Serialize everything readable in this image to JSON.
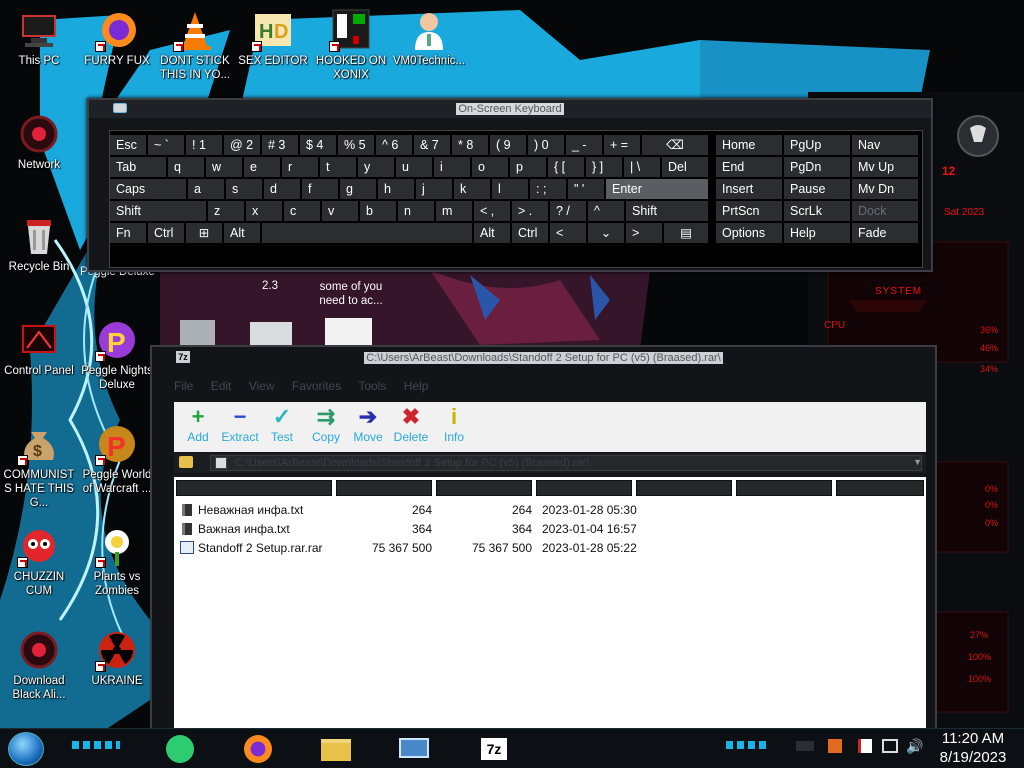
{
  "desktop": {
    "icons": [
      {
        "label": "This PC"
      },
      {
        "label": "FURRY FUX"
      },
      {
        "label": "DONT STICK THIS IN YO..."
      },
      {
        "label": "SEX EDITOR"
      },
      {
        "label": "HOOKED ON XONIX"
      },
      {
        "label": "VM0Technic..."
      },
      {
        "label": "Network"
      },
      {
        "label": "Recycle Bin"
      },
      {
        "label": "Control Panel"
      },
      {
        "label": "Peggle Nights Deluxe"
      },
      {
        "label": "COMMUNISTS HATE THIS G..."
      },
      {
        "label": "Peggle World of Warcraft ..."
      },
      {
        "label": "CHUZZIN CUM"
      },
      {
        "label": "Plants vs Zombies"
      },
      {
        "label": "Download Black Ali..."
      },
      {
        "label": "UKRAINE"
      }
    ],
    "hidden_labels": [
      "Peggle Deluxe",
      "2.3",
      "some of you need to ac..."
    ]
  },
  "osk": {
    "title": "On-Screen Keyboard",
    "row1": [
      "Esc",
      "~ `",
      "! 1",
      "@ 2",
      "# 3",
      "$ 4",
      "% 5",
      "^ 6",
      "& 7",
      "* 8",
      "( 9",
      ") 0",
      "_ -",
      "+ =",
      "⌫"
    ],
    "row2": [
      "Tab",
      "q",
      "w",
      "e",
      "r",
      "t",
      "y",
      "u",
      "i",
      "o",
      "p",
      "{ [",
      "} ]",
      "| \\",
      "Del"
    ],
    "row3": [
      "Caps",
      "a",
      "s",
      "d",
      "f",
      "g",
      "h",
      "j",
      "k",
      "l",
      ": ;",
      "\" '",
      "Enter"
    ],
    "row4": [
      "Shift",
      "z",
      "x",
      "c",
      "v",
      "b",
      "n",
      "m",
      "< ,",
      "> .",
      "? /",
      "^",
      "Shift"
    ],
    "row5": [
      "Fn",
      "Ctrl",
      "⊞",
      "Alt",
      "Alt",
      "Ctrl",
      "<",
      "⌄",
      ">",
      "▤"
    ],
    "nav": [
      [
        "Home",
        "PgUp",
        "Nav"
      ],
      [
        "End",
        "PgDn",
        "Mv Up"
      ],
      [
        "Insert",
        "Pause",
        "Mv Dn"
      ],
      [
        "PrtScn",
        "ScrLk",
        "Dock"
      ],
      [
        "Options",
        "Help",
        "Fade"
      ]
    ]
  },
  "zip": {
    "title": "C:\\Users\\ArBeast\\Downloads\\Standoff 2 Setup for PC (v5) (Braased).rar\\",
    "menu": [
      "File",
      "Edit",
      "View",
      "Favorites",
      "Tools",
      "Help"
    ],
    "toolbar": [
      {
        "label": "Add",
        "icon": "plus",
        "color": "#1fa33a"
      },
      {
        "label": "Extract",
        "icon": "minus",
        "color": "#2a4bd0"
      },
      {
        "label": "Test",
        "icon": "check",
        "color": "#2cb6c7"
      },
      {
        "label": "Copy",
        "icon": "double-arrow",
        "color": "#2c9a6a"
      },
      {
        "label": "Move",
        "icon": "arrow",
        "color": "#2a2fb0"
      },
      {
        "label": "Delete",
        "icon": "x",
        "color": "#d0252b"
      },
      {
        "label": "Info",
        "icon": "info",
        "color": "#c8b400"
      }
    ],
    "address": "C:\\Users\\ArBeast\\Downloads\\Standoff 2 Setup for PC (v5) (Braased).rar\\",
    "files": [
      {
        "name": "Неважная инфа.txt",
        "size": "264",
        "packed": "264",
        "modified": "2023-01-28 05:30",
        "type": "txt"
      },
      {
        "name": "Важная инфа.txt",
        "size": "364",
        "packed": "364",
        "modified": "2023-01-04 16:57",
        "type": "txt"
      },
      {
        "name": "Standoff 2 Setup.rar.rar",
        "size": "75 367 500",
        "packed": "75 367 500",
        "modified": "2023-01-28 05:22",
        "type": "rar"
      }
    ]
  },
  "rpanel": {
    "labels": [
      "12",
      "Sat 2023",
      "SYSTEM",
      "CPU",
      "36%",
      "46%",
      "34%",
      "0%",
      "0%",
      "0%",
      "27%",
      "100%",
      "100%"
    ]
  },
  "taskbar": {
    "time": "11:20 AM",
    "date": "8/19/2023",
    "apps": [
      "green-notes-app",
      "firefox",
      "file-explorer",
      "network-window",
      "7zip"
    ]
  },
  "colors": {
    "accent": "#19b3e6",
    "red": "#d41f28"
  }
}
